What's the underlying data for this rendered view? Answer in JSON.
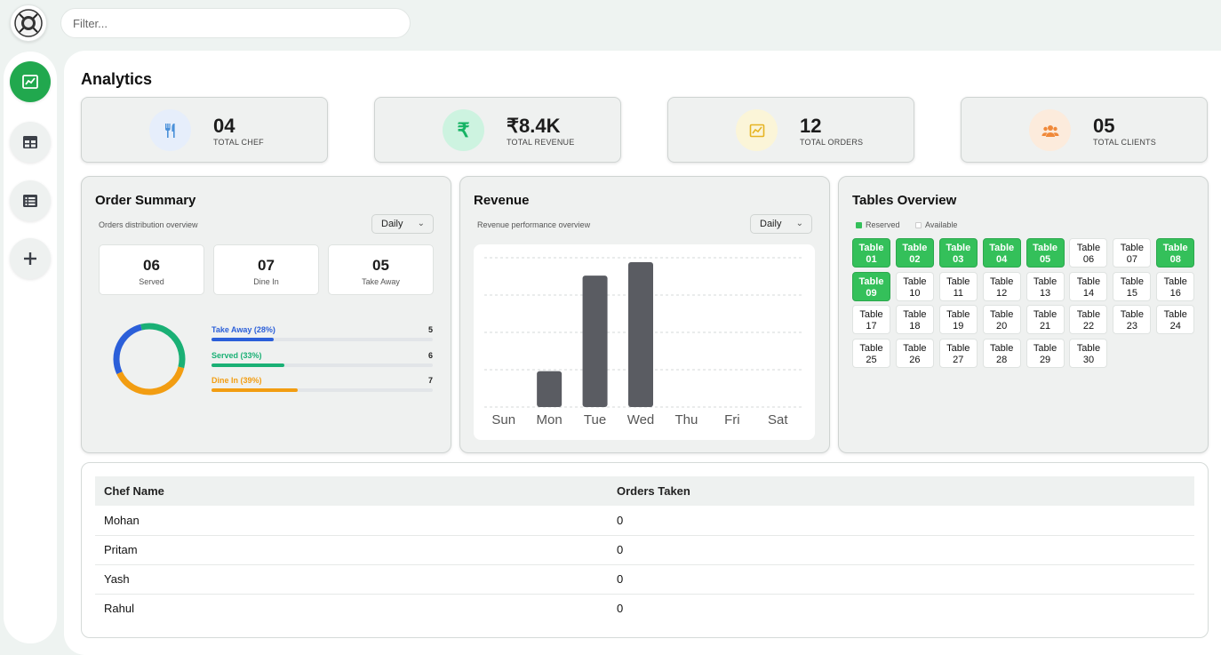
{
  "search": {
    "placeholder": "Filter..."
  },
  "sidebar": {
    "items": [
      {
        "icon": "analytics-icon",
        "active": true
      },
      {
        "icon": "tables-icon",
        "active": false
      },
      {
        "icon": "menu-list-icon",
        "active": false
      },
      {
        "icon": "add-icon",
        "active": false
      }
    ]
  },
  "page": {
    "title": "Analytics"
  },
  "stats": [
    {
      "value": "04",
      "label": "Total Chef",
      "icon": "fork-knife-icon",
      "color": "#4a90d9"
    },
    {
      "value": "₹8.4K",
      "label": "Total Revenue",
      "icon": "rupee-icon",
      "color": "#16b364"
    },
    {
      "value": "12",
      "label": "Total Orders",
      "icon": "chart-icon",
      "color": "#e6b422"
    },
    {
      "value": "05",
      "label": "Total Clients",
      "icon": "users-icon",
      "color": "#f0893a"
    }
  ],
  "order_summary": {
    "title": "Order Summary",
    "subtitle": "Orders distribution overview",
    "period": "Daily",
    "counts": [
      {
        "value": "06",
        "label": "Served"
      },
      {
        "value": "07",
        "label": "Dine In"
      },
      {
        "value": "05",
        "label": "Take Away"
      }
    ],
    "breakdown": [
      {
        "label": "Take Away (28%)",
        "count": "5",
        "percent": 28,
        "color": "#2b5fd9"
      },
      {
        "label": "Served (33%)",
        "count": "6",
        "percent": 33,
        "color": "#1ab075"
      },
      {
        "label": "Dine In (39%)",
        "count": "7",
        "percent": 39,
        "color": "#f29d12"
      }
    ]
  },
  "revenue": {
    "title": "Revenue",
    "subtitle": "Revenue performance overview",
    "period": "Daily"
  },
  "chart_data": {
    "type": "bar",
    "categories": [
      "Sun",
      "Mon",
      "Tue",
      "Wed",
      "Thu",
      "Fri",
      "Sat"
    ],
    "values": [
      0,
      24,
      88,
      97,
      0,
      0,
      0
    ],
    "ylim": [
      0,
      100
    ],
    "grid": true,
    "color": "#5a5c62"
  },
  "tables_overview": {
    "title": "Tables Overview",
    "legend": {
      "reserved": "Reserved",
      "available": "Available"
    },
    "tables": [
      {
        "name": "Table",
        "num": "01",
        "reserved": true
      },
      {
        "name": "Table",
        "num": "02",
        "reserved": true
      },
      {
        "name": "Table",
        "num": "03",
        "reserved": true
      },
      {
        "name": "Table",
        "num": "04",
        "reserved": true
      },
      {
        "name": "Table",
        "num": "05",
        "reserved": true
      },
      {
        "name": "Table",
        "num": "06",
        "reserved": false
      },
      {
        "name": "Table",
        "num": "07",
        "reserved": false
      },
      {
        "name": "Table",
        "num": "08",
        "reserved": true
      },
      {
        "name": "Table",
        "num": "09",
        "reserved": true
      },
      {
        "name": "Table",
        "num": "10",
        "reserved": false
      },
      {
        "name": "Table",
        "num": "11",
        "reserved": false
      },
      {
        "name": "Table",
        "num": "12",
        "reserved": false
      },
      {
        "name": "Table",
        "num": "13",
        "reserved": false
      },
      {
        "name": "Table",
        "num": "14",
        "reserved": false
      },
      {
        "name": "Table",
        "num": "15",
        "reserved": false
      },
      {
        "name": "Table",
        "num": "16",
        "reserved": false
      },
      {
        "name": "Table",
        "num": "17",
        "reserved": false
      },
      {
        "name": "Table",
        "num": "18",
        "reserved": false
      },
      {
        "name": "Table",
        "num": "19",
        "reserved": false
      },
      {
        "name": "Table",
        "num": "20",
        "reserved": false
      },
      {
        "name": "Table",
        "num": "21",
        "reserved": false
      },
      {
        "name": "Table",
        "num": "22",
        "reserved": false
      },
      {
        "name": "Table",
        "num": "23",
        "reserved": false
      },
      {
        "name": "Table",
        "num": "24",
        "reserved": false
      },
      {
        "name": "Table",
        "num": "25",
        "reserved": false
      },
      {
        "name": "Table",
        "num": "26",
        "reserved": false
      },
      {
        "name": "Table",
        "num": "27",
        "reserved": false
      },
      {
        "name": "Table",
        "num": "28",
        "reserved": false
      },
      {
        "name": "Table",
        "num": "29",
        "reserved": false
      },
      {
        "name": "Table",
        "num": "30",
        "reserved": false
      }
    ]
  },
  "chefs": {
    "headers": [
      "Chef Name",
      "Orders Taken"
    ],
    "rows": [
      [
        "Mohan",
        "0"
      ],
      [
        "Pritam",
        "0"
      ],
      [
        "Yash",
        "0"
      ],
      [
        "Rahul",
        "0"
      ]
    ]
  }
}
